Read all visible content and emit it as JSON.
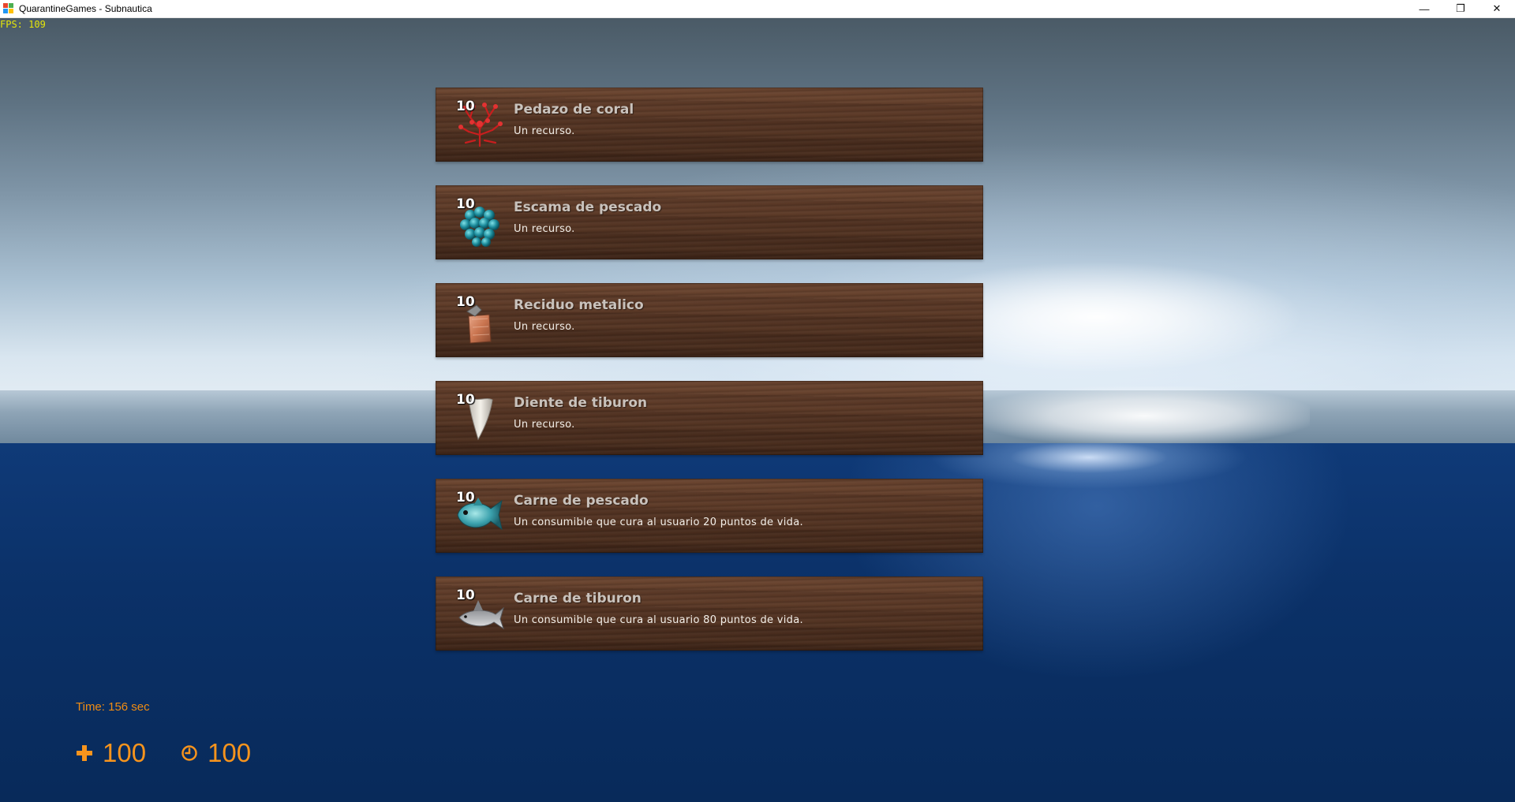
{
  "window": {
    "title": "QuarantineGames - Subnautica",
    "minimize": "—",
    "restore": "❐",
    "close": "✕"
  },
  "fps_label": "FPS: 109",
  "inventory": {
    "items": [
      {
        "count": "10",
        "name": "Pedazo de coral",
        "description": "Un recurso.",
        "icon": "coral-icon"
      },
      {
        "count": "10",
        "name": "Escama de pescado",
        "description": "Un recurso.",
        "icon": "fish-scale-icon"
      },
      {
        "count": "10",
        "name": "Reciduo metalico",
        "description": "Un recurso.",
        "icon": "metal-scrap-icon"
      },
      {
        "count": "10",
        "name": "Diente de tiburon",
        "description": "Un recurso.",
        "icon": "shark-tooth-icon"
      },
      {
        "count": "10",
        "name": "Carne de pescado",
        "description": "Un consumible que cura al usuario 20 puntos de vida.",
        "icon": "fish-icon"
      },
      {
        "count": "10",
        "name": "Carne de tiburon",
        "description": "Un consumible que cura al usuario 80 puntos de vida.",
        "icon": "shark-icon"
      }
    ]
  },
  "hud": {
    "time": "Time: 156 sec",
    "health": "100",
    "oxygen": "100",
    "accent_color": "#f7941d"
  }
}
